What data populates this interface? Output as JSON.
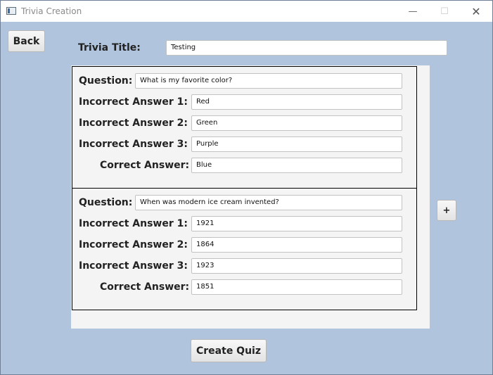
{
  "window": {
    "title": "Trivia Creation",
    "controls": {
      "minimize": "—",
      "maximize": "☐",
      "close": "✕"
    }
  },
  "back_label": "Back",
  "trivia_title": {
    "label": "Trivia Title:",
    "value": "Testing"
  },
  "labels": {
    "question": "Question:",
    "incorrect1": "Incorrect Answer 1:",
    "incorrect2": "Incorrect Answer 2:",
    "incorrect3": "Incorrect Answer 3:",
    "correct": "Correct Answer:"
  },
  "questions": [
    {
      "question": "What is my favorite color?",
      "incorrect": [
        "Red",
        "Green",
        "Purple"
      ],
      "correct": "Blue"
    },
    {
      "question": "When was modern ice cream invented?",
      "incorrect": [
        "1921",
        "1864",
        "1923"
      ],
      "correct": "1851"
    }
  ],
  "add_label": "+",
  "create_label": "Create Quiz"
}
